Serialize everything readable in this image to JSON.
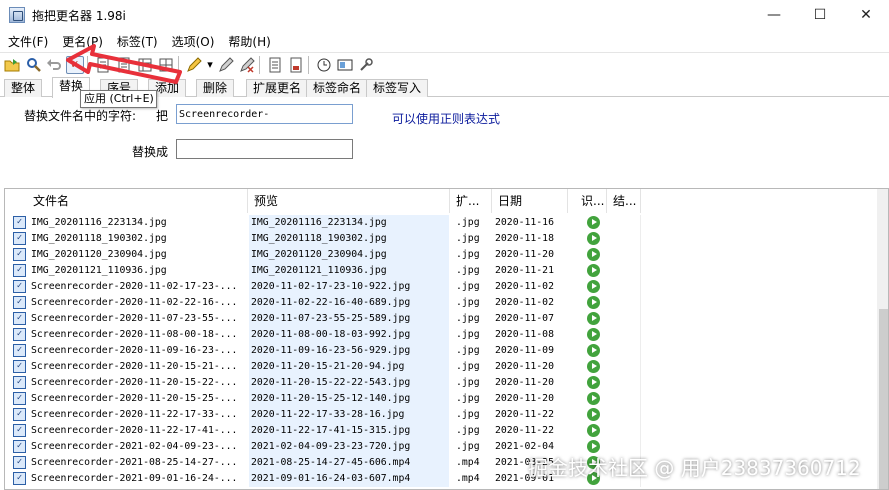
{
  "window": {
    "title": "拖把更名器 1.98i",
    "minimize": "—",
    "maximize": "☐",
    "close": "✕"
  },
  "menu": [
    "文件(F)",
    "更名(P)",
    "标签(T)",
    "选项(O)",
    "帮助(H)"
  ],
  "toolbar": {
    "icons": [
      "open-folder-icon",
      "search-icon",
      "undo-icon",
      "apply-check-icon",
      "doc-icon",
      "list-icon",
      "table-icon",
      "grid-icon",
      "rename-pen-icon",
      "dropdown-arrow-icon",
      "edit-pen-icon",
      "erase-icon",
      "list-view-icon",
      "export-icon",
      "clock-icon",
      "panel-icon",
      "tools-icon"
    ]
  },
  "tabs": [
    "整体",
    "替换",
    "序号",
    "添加",
    "删除",
    "扩展更名",
    "标签命名",
    "标签写入"
  ],
  "tooltip": "应用 (Ctrl+E)",
  "replace_panel": {
    "find_label": "替换文件名中的字符:",
    "find_prefix": "把",
    "find_value": "Screenrecorder-",
    "regex_note": "可以使用正则表达式",
    "replace_label": "替换成",
    "replace_value": ""
  },
  "list": {
    "columns": [
      "文件名",
      "预览",
      "扩...",
      "日期",
      "识...",
      "结..."
    ],
    "rows": [
      {
        "name": "IMG_20201116_223134.jpg",
        "preview": "IMG_20201116_223134.jpg",
        "ext": ".jpg",
        "date": "2020-11-16"
      },
      {
        "name": "IMG_20201118_190302.jpg",
        "preview": "IMG_20201118_190302.jpg",
        "ext": ".jpg",
        "date": "2020-11-18"
      },
      {
        "name": "IMG_20201120_230904.jpg",
        "preview": "IMG_20201120_230904.jpg",
        "ext": ".jpg",
        "date": "2020-11-20"
      },
      {
        "name": "IMG_20201121_110936.jpg",
        "preview": "IMG_20201121_110936.jpg",
        "ext": ".jpg",
        "date": "2020-11-21"
      },
      {
        "name": "Screenrecorder-2020-11-02-17-23-...",
        "preview": "2020-11-02-17-23-10-922.jpg",
        "ext": ".jpg",
        "date": "2020-11-02"
      },
      {
        "name": "Screenrecorder-2020-11-02-22-16-...",
        "preview": "2020-11-02-22-16-40-689.jpg",
        "ext": ".jpg",
        "date": "2020-11-02"
      },
      {
        "name": "Screenrecorder-2020-11-07-23-55-...",
        "preview": "2020-11-07-23-55-25-589.jpg",
        "ext": ".jpg",
        "date": "2020-11-07"
      },
      {
        "name": "Screenrecorder-2020-11-08-00-18-...",
        "preview": "2020-11-08-00-18-03-992.jpg",
        "ext": ".jpg",
        "date": "2020-11-08"
      },
      {
        "name": "Screenrecorder-2020-11-09-16-23-...",
        "preview": "2020-11-09-16-23-56-929.jpg",
        "ext": ".jpg",
        "date": "2020-11-09"
      },
      {
        "name": "Screenrecorder-2020-11-20-15-21-...",
        "preview": "2020-11-20-15-21-20-94.jpg",
        "ext": ".jpg",
        "date": "2020-11-20"
      },
      {
        "name": "Screenrecorder-2020-11-20-15-22-...",
        "preview": "2020-11-20-15-22-22-543.jpg",
        "ext": ".jpg",
        "date": "2020-11-20"
      },
      {
        "name": "Screenrecorder-2020-11-20-15-25-...",
        "preview": "2020-11-20-15-25-12-140.jpg",
        "ext": ".jpg",
        "date": "2020-11-20"
      },
      {
        "name": "Screenrecorder-2020-11-22-17-33-...",
        "preview": "2020-11-22-17-33-28-16.jpg",
        "ext": ".jpg",
        "date": "2020-11-22"
      },
      {
        "name": "Screenrecorder-2020-11-22-17-41-...",
        "preview": "2020-11-22-17-41-15-315.jpg",
        "ext": ".jpg",
        "date": "2020-11-22"
      },
      {
        "name": "Screenrecorder-2021-02-04-09-23-...",
        "preview": "2021-02-04-09-23-23-720.jpg",
        "ext": ".jpg",
        "date": "2021-02-04"
      },
      {
        "name": "Screenrecorder-2021-08-25-14-27-...",
        "preview": "2021-08-25-14-27-45-606.mp4",
        "ext": ".mp4",
        "date": "2021-08-25"
      },
      {
        "name": "Screenrecorder-2021-09-01-16-24-...",
        "preview": "2021-09-01-16-24-03-607.mp4",
        "ext": ".mp4",
        "date": "2021-09-01"
      }
    ]
  },
  "watermark": "掘金技术社区 @ 用户2383736​0712",
  "colors": {
    "accent": "#e8303a",
    "status_ok": "#42a33d",
    "link": "#0a1a9c"
  }
}
